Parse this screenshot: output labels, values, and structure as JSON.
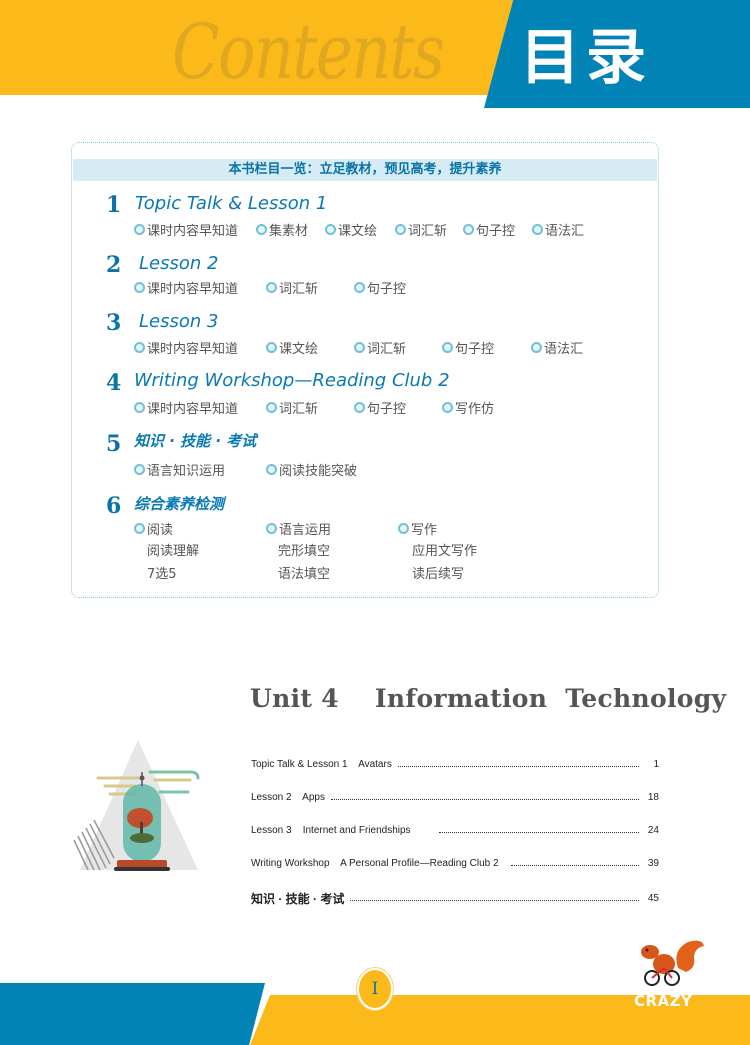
{
  "header": {
    "watermark": "Contents",
    "title": "目录",
    "colors": {
      "yellow": "#fbb91a",
      "blue": "#0183b6"
    }
  },
  "overview": {
    "banner": "本书栏目一览：立足教材，预见高考，提升素养",
    "sections": [
      {
        "num": "1",
        "title": "Topic Talk & Lesson 1",
        "items": [
          "课时内容早知道",
          "集素材",
          "课文绘",
          "词汇斩",
          "句子控",
          "语法汇"
        ]
      },
      {
        "num": "2",
        "title": "Lesson 2",
        "items": [
          "课时内容早知道",
          "词汇斩",
          "句子控"
        ]
      },
      {
        "num": "3",
        "title": "Lesson 3",
        "items": [
          "课时内容早知道",
          "课文绘",
          "词汇斩",
          "句子控",
          "语法汇"
        ]
      },
      {
        "num": "4",
        "title": "Writing Workshop—Reading Club 2",
        "items": [
          "课时内容早知道",
          "词汇斩",
          "句子控",
          "写作仿"
        ]
      },
      {
        "num": "5",
        "title": "知识 · 技能 · 考试",
        "items": [
          "语言知识运用",
          "阅读技能突破"
        ]
      },
      {
        "num": "6",
        "title": "综合素养检测",
        "groups": [
          {
            "label": "阅读",
            "subs": [
              "阅读理解",
              "7选5"
            ]
          },
          {
            "label": "语言运用",
            "subs": [
              "完形填空",
              "语法填空"
            ]
          },
          {
            "label": "写作",
            "subs": [
              "应用文写作",
              "读后续写"
            ]
          }
        ]
      }
    ]
  },
  "unit": {
    "title": "Unit 4    Information  Technology",
    "toc": [
      {
        "label": "Topic Talk & Lesson 1    Avatars",
        "page": "1"
      },
      {
        "label": "Lesson 2    Apps",
        "page": "18"
      },
      {
        "label": "Lesson 3    Internet and Friendships",
        "page": "24"
      },
      {
        "label": "Writing Workshop    A Personal Profile—Reading Club 2",
        "page": "39"
      },
      {
        "label": "知识 · 技能 · 考试",
        "page": "45"
      }
    ]
  },
  "footer": {
    "page_number": "I",
    "mascot_text": "CRAZY"
  }
}
